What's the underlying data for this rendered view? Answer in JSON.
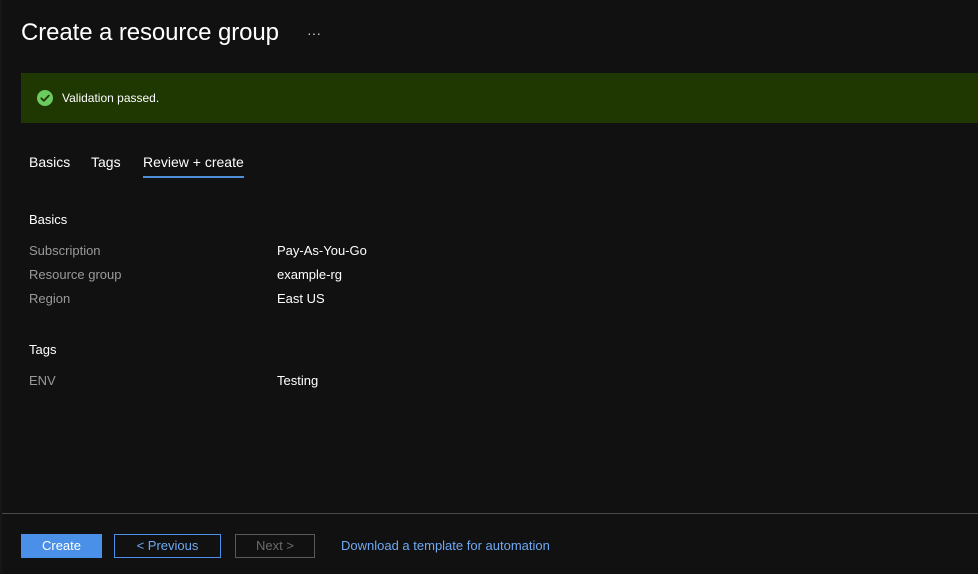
{
  "header": {
    "title": "Create a resource group",
    "more_label": "···"
  },
  "validation": {
    "message": "Validation passed.",
    "icon": "check-circle-icon",
    "banner_color": "#1f3700",
    "icon_color": "#6ccb5f"
  },
  "tabs": [
    {
      "label": "Basics",
      "active": false
    },
    {
      "label": "Tags",
      "active": false
    },
    {
      "label": "Review + create",
      "active": true
    }
  ],
  "review": {
    "basics": {
      "heading": "Basics",
      "fields": [
        {
          "label": "Subscription",
          "value": "Pay-As-You-Go"
        },
        {
          "label": "Resource group",
          "value": "example-rg"
        },
        {
          "label": "Region",
          "value": "East US"
        }
      ]
    },
    "tags": {
      "heading": "Tags",
      "fields": [
        {
          "label": "ENV",
          "value": "Testing"
        }
      ]
    }
  },
  "footer": {
    "create_label": "Create",
    "previous_label": "< Previous",
    "next_label": "Next >",
    "download_label": "Download a template for automation"
  },
  "colors": {
    "accent": "#4a8fe8",
    "link": "#6ea8f2",
    "background": "#111111"
  }
}
